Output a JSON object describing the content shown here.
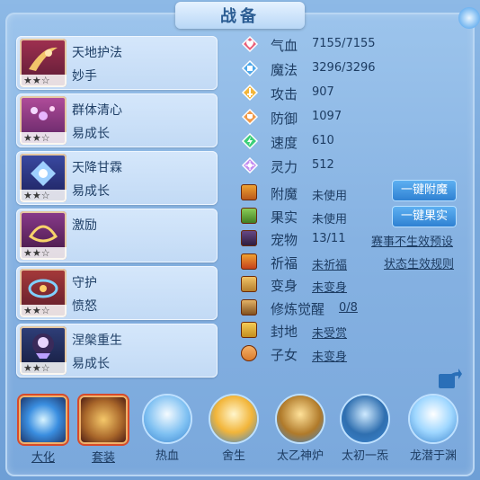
{
  "title": "战备",
  "skills": [
    {
      "name": "天地护法",
      "sub": "妙手",
      "stars": "★★☆"
    },
    {
      "name": "群体清心",
      "sub": "易成长",
      "stars": "★★☆"
    },
    {
      "name": "天降甘霖",
      "sub": "易成长",
      "stars": "★★☆"
    },
    {
      "name": "激励",
      "sub": "",
      "stars": "★★☆"
    },
    {
      "name": "守护",
      "sub": "愤怒",
      "stars": "★★☆"
    },
    {
      "name": "涅槃重生",
      "sub": "易成长",
      "stars": "★★☆"
    }
  ],
  "stats": [
    {
      "label": "气血",
      "value": "7155/7155",
      "icon": "heart-icon",
      "color": "#e8607a"
    },
    {
      "label": "魔法",
      "value": "3296/3296",
      "icon": "mana-icon",
      "color": "#4ea7ea"
    },
    {
      "label": "攻击",
      "value": "907",
      "icon": "attack-icon",
      "color": "#f2b53a"
    },
    {
      "label": "防御",
      "value": "1097",
      "icon": "defense-icon",
      "color": "#f09a4a"
    },
    {
      "label": "速度",
      "value": "610",
      "icon": "speed-icon",
      "color": "#3ccf7a"
    },
    {
      "label": "灵力",
      "value": "512",
      "icon": "spirit-icon",
      "color": "#c48ef0"
    }
  ],
  "status": [
    {
      "label": "附魔",
      "value": "未使用"
    },
    {
      "label": "果实",
      "value": "未使用"
    },
    {
      "label": "宠物",
      "value": "13/11"
    },
    {
      "label": "祈福",
      "value": "未祈福"
    },
    {
      "label": "变身",
      "value": "未变身"
    },
    {
      "label": "修炼觉醒",
      "value": "0/8"
    },
    {
      "label": "封地",
      "value": "未受赏"
    },
    {
      "label": "子女",
      "value": "未变身"
    }
  ],
  "buttons": {
    "enchant": "一键附魔",
    "fruit": "一键果实"
  },
  "links": {
    "preset": "赛事不生效预设",
    "rule": "状态生效规则"
  },
  "bottom": [
    {
      "label": "大化"
    },
    {
      "label": "套装"
    },
    {
      "label": "热血"
    },
    {
      "label": "舍生"
    },
    {
      "label": "太乙神炉"
    },
    {
      "label": "太初一炁"
    },
    {
      "label": "龙潜于渊"
    }
  ]
}
